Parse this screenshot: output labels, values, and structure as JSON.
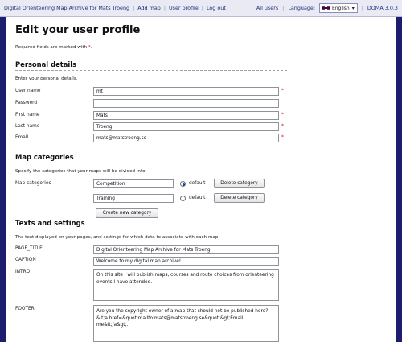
{
  "topbar": {
    "nav": [
      "Digital Orienteering Map Archive for Mats Troeng",
      "Add map",
      "User profile",
      "Log out"
    ],
    "all_users": "All users",
    "language_label": "Language:",
    "language_value": "English",
    "version": "DOMA 3.0.3"
  },
  "page": {
    "title": "Edit your user profile",
    "required_text": "Required fields are marked with",
    "required_star": "*",
    "required_end": "."
  },
  "personal": {
    "heading": "Personal details",
    "description": "Enter your personal details.",
    "fields": [
      {
        "label": "User name",
        "value": "mt",
        "required": true
      },
      {
        "label": "Password",
        "value": "",
        "required": false
      },
      {
        "label": "First name",
        "value": "Mats",
        "required": true
      },
      {
        "label": "Last name",
        "value": "Troeng",
        "required": true
      },
      {
        "label": "Email",
        "value": "mats@matstroeng.se",
        "required": true
      }
    ]
  },
  "categories": {
    "heading": "Map categories",
    "description": "Specify the categories that your maps will be divided into.",
    "label": "Map categories",
    "items": [
      {
        "name": "Competition",
        "default_label": "default",
        "is_default": true,
        "delete_label": "Delete category"
      },
      {
        "name": "Training",
        "default_label": "default",
        "is_default": false,
        "delete_label": "Delete category"
      }
    ],
    "create_label": "Create new category"
  },
  "texts": {
    "heading": "Texts and settings",
    "description": "The text displayed on your pages, and settings for which data to associate with each map.",
    "page_title_label": "PAGE_TITLE",
    "page_title_value": "Digital Orienteering Map Archive for Mats Troeng",
    "caption_label": "CAPTION",
    "caption_value": "Welcome to my digital map archive!",
    "intro_label": "INTRO",
    "intro_value": "On this site I will publish maps, courses and route choices from orienteering events I have attended.",
    "footer_label": "FOOTER",
    "footer_value": "Are you the copyright owner of a map that should not be published here? &lt;a href=&quot;mailto:mats@matstroeng.se&quot;&gt;Email me&lt;/a&gt;."
  },
  "colors": {
    "background": "#1d1d6e",
    "topbar": "#e9eaf4",
    "required": "#dd1111"
  }
}
